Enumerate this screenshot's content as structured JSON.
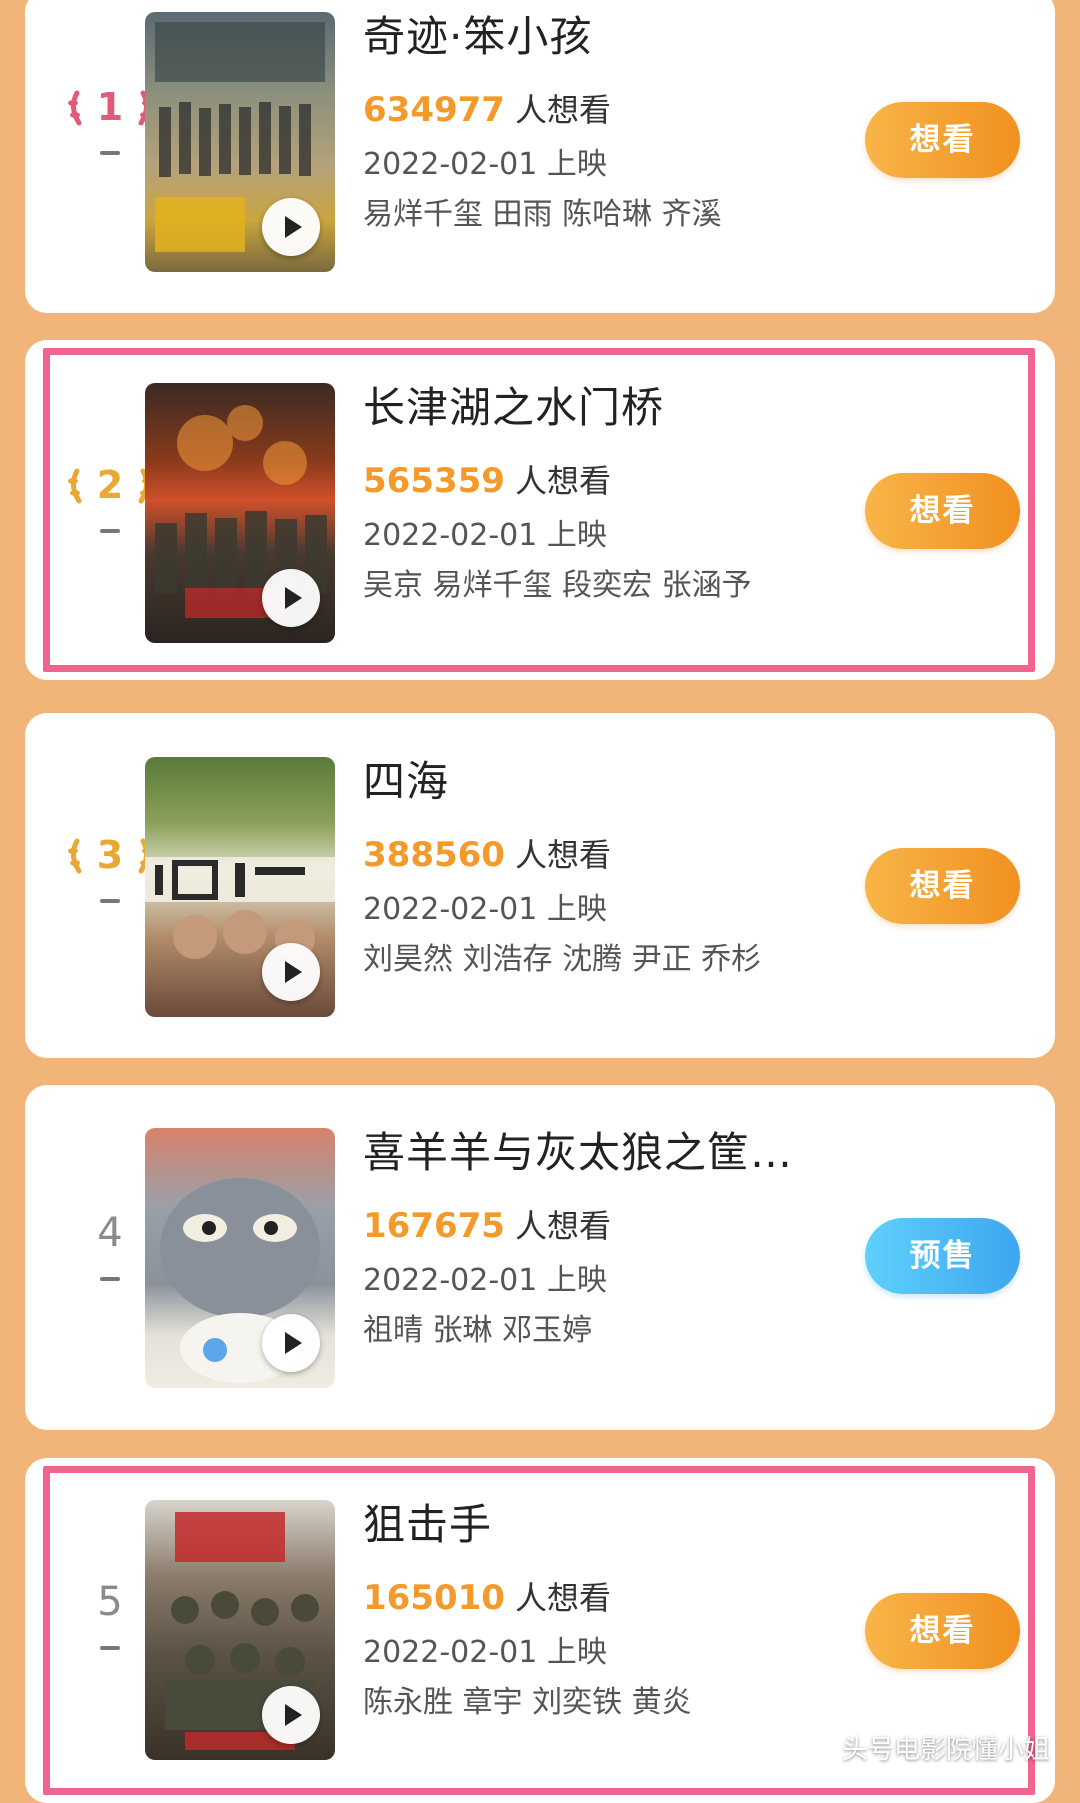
{
  "want_suffix": "人想看",
  "release_suffix": "上映",
  "movies": [
    {
      "rank": "1",
      "title": "奇迹·笨小孩",
      "want_count": "634977",
      "release_date": "2022-02-01",
      "cast": "易烊千玺 田雨 陈哈琳 齐溪",
      "button": "想看",
      "highlighted": false
    },
    {
      "rank": "2",
      "title": "长津湖之水门桥",
      "want_count": "565359",
      "release_date": "2022-02-01",
      "cast": "吴京 易烊千玺 段奕宏 张涵予",
      "button": "想看",
      "highlighted": true
    },
    {
      "rank": "3",
      "title": "四海",
      "want_count": "388560",
      "release_date": "2022-02-01",
      "cast": "刘昊然 刘浩存 沈腾 尹正 乔杉",
      "button": "想看",
      "highlighted": false
    },
    {
      "rank": "4",
      "title": "喜羊羊与灰太狼之筐…",
      "want_count": "167675",
      "release_date": "2022-02-01",
      "cast": "祖晴 张琳 邓玉婷",
      "button": "预售",
      "highlighted": false
    },
    {
      "rank": "5",
      "title": "狙击手",
      "want_count": "165010",
      "release_date": "2022-02-01",
      "cast": "陈永胜 章宇 刘奕铁 黄炎",
      "button": "想看",
      "highlighted": true
    }
  ],
  "colors": {
    "page_bg": "#f1b57a",
    "want_count": "#f39a2b",
    "highlight_border": "#f0648e",
    "button_orange": "#f5a030",
    "button_blue": "#4db8f5",
    "rank_1": "#e25a7a",
    "rank_2_3": "#e9a733"
  },
  "watermark": "头号电影院懂小姐"
}
